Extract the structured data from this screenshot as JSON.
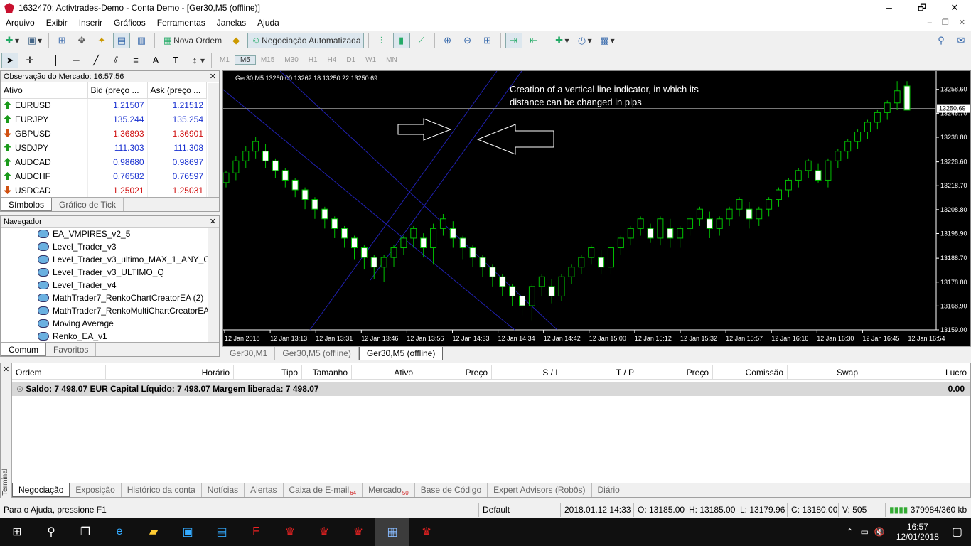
{
  "window": {
    "title": "1632470: Activtrades-Demo - Conta Demo - [Ger30,M5 (offline)]",
    "minimize": "🗕",
    "restore": "🗗",
    "close": "✕"
  },
  "menu": [
    "Arquivo",
    "Exibir",
    "Inserir",
    "Gráficos",
    "Ferramentas",
    "Janelas",
    "Ajuda"
  ],
  "toolbar": {
    "new_order": "Nova Ordem",
    "auto_trading": "Negociação Automatizada"
  },
  "timeframes": [
    "M1",
    "M5",
    "M15",
    "M30",
    "H1",
    "H4",
    "D1",
    "W1",
    "MN"
  ],
  "active_timeframe": "M5",
  "market_watch": {
    "title": "Observação do Mercado: 16:57:56",
    "columns": [
      "Ativo",
      "Bid (preço ...",
      "Ask (preço ..."
    ],
    "rows": [
      {
        "symbol": "EURUSD",
        "bid": "1.21507",
        "ask": "1.21512",
        "dir": "up",
        "color": "blue"
      },
      {
        "symbol": "EURJPY",
        "bid": "135.244",
        "ask": "135.254",
        "dir": "up",
        "color": "blue"
      },
      {
        "symbol": "GBPUSD",
        "bid": "1.36893",
        "ask": "1.36901",
        "dir": "down",
        "color": "red"
      },
      {
        "symbol": "USDJPY",
        "bid": "111.303",
        "ask": "111.308",
        "dir": "up",
        "color": "blue"
      },
      {
        "symbol": "AUDCAD",
        "bid": "0.98680",
        "ask": "0.98697",
        "dir": "up",
        "color": "blue"
      },
      {
        "symbol": "AUDCHF",
        "bid": "0.76582",
        "ask": "0.76597",
        "dir": "up",
        "color": "blue"
      },
      {
        "symbol": "USDCAD",
        "bid": "1.25021",
        "ask": "1.25031",
        "dir": "down",
        "color": "red"
      }
    ],
    "tabs": [
      "Símbolos",
      "Gráfico de Tick"
    ]
  },
  "navigator": {
    "title": "Navegador",
    "items": [
      "EA_VMPIRES_v2_5",
      "Level_Trader_v3",
      "Level_Trader_v3_ultimo_MAX_1_ANY_OR",
      "Level_Trader_v3_ULTIMO_Q",
      "Level_Trader_v4",
      "MathTrader7_RenkoChartCreatorEA (2)",
      "MathTrader7_RenkoMultiChartCreatorEA",
      "Moving Average",
      "Renko_EA_v1"
    ],
    "tabs": [
      "Comum",
      "Favoritos"
    ]
  },
  "chart": {
    "header": "Ger30,M5  13260.00 13262.18 13250.22 13250.69",
    "annotation_line1": "Creation of a vertical line indicator, in which its",
    "annotation_line2": "distance can be changed in pips",
    "current_price": "13250.69",
    "tabs": [
      "Ger30,M1",
      "Ger30,M5 (offline)",
      "Ger30,M5 (offline)"
    ]
  },
  "chart_data": {
    "type": "candlestick",
    "symbol": "Ger30,M5",
    "ylim": [
      13159,
      13265
    ],
    "y_ticks": [
      "13258.60",
      "13248.70",
      "13238.80",
      "13228.60",
      "13218.70",
      "13208.80",
      "13198.90",
      "13188.70",
      "13178.80",
      "13168.90",
      "13159.00"
    ],
    "x_ticks": [
      "12 Jan 2018",
      "12 Jan 13:13",
      "12 Jan 13:31",
      "12 Jan 13:46",
      "12 Jan 13:56",
      "12 Jan 14:33",
      "12 Jan 14:34",
      "12 Jan 14:42",
      "12 Jan 15:00",
      "12 Jan 15:12",
      "12 Jan 15:32",
      "12 Jan 15:57",
      "12 Jan 16:16",
      "12 Jan 16:30",
      "12 Jan 16:45",
      "12 Jan 16:54"
    ],
    "ohlc": [
      [
        13220,
        13225,
        13218,
        13224
      ],
      [
        13224,
        13231,
        13221,
        13229
      ],
      [
        13229,
        13235,
        13226,
        13233
      ],
      [
        13233,
        13239,
        13230,
        13237
      ],
      [
        13233,
        13236,
        13226,
        13229
      ],
      [
        13229,
        13230,
        13222,
        13225
      ],
      [
        13225,
        13226,
        13218,
        13221
      ],
      [
        13221,
        13222,
        13214,
        13217
      ],
      [
        13217,
        13218,
        13209,
        13213
      ],
      [
        13213,
        13214,
        13205,
        13209
      ],
      [
        13209,
        13210,
        13201,
        13205
      ],
      [
        13205,
        13206,
        13197,
        13201
      ],
      [
        13201,
        13202,
        13193,
        13197
      ],
      [
        13197,
        13198,
        13188,
        13193
      ],
      [
        13193,
        13194,
        13184,
        13189
      ],
      [
        13189,
        13190,
        13180,
        13185
      ],
      [
        13185,
        13190,
        13179,
        13189
      ],
      [
        13189,
        13194,
        13185,
        13193
      ],
      [
        13193,
        13198,
        13190,
        13197
      ],
      [
        13197,
        13202,
        13193,
        13201
      ],
      [
        13197,
        13199,
        13189,
        13193
      ],
      [
        13193,
        13203,
        13186,
        13201
      ],
      [
        13201,
        13207,
        13198,
        13205
      ],
      [
        13201,
        13204,
        13193,
        13197
      ],
      [
        13197,
        13198,
        13188,
        13193
      ],
      [
        13193,
        13194,
        13185,
        13189
      ],
      [
        13189,
        13190,
        13181,
        13185
      ],
      [
        13185,
        13186,
        13177,
        13181
      ],
      [
        13181,
        13182,
        13173,
        13177
      ],
      [
        13177,
        13178,
        13169,
        13173
      ],
      [
        13173,
        13174,
        13165,
        13169
      ],
      [
        13169,
        13178,
        13163,
        13177
      ],
      [
        13177,
        13182,
        13173,
        13181
      ],
      [
        13177,
        13180,
        13170,
        13173
      ],
      [
        13173,
        13182,
        13171,
        13181
      ],
      [
        13181,
        13186,
        13178,
        13185
      ],
      [
        13185,
        13190,
        13182,
        13189
      ],
      [
        13189,
        13194,
        13186,
        13193
      ],
      [
        13189,
        13192,
        13182,
        13185
      ],
      [
        13185,
        13194,
        13182,
        13193
      ],
      [
        13193,
        13198,
        13190,
        13197
      ],
      [
        13197,
        13202,
        13194,
        13201
      ],
      [
        13201,
        13206,
        13198,
        13205
      ],
      [
        13201,
        13203,
        13195,
        13197
      ],
      [
        13197,
        13206,
        13194,
        13205
      ],
      [
        13201,
        13205,
        13193,
        13197
      ],
      [
        13197,
        13202,
        13193,
        13201
      ],
      [
        13201,
        13206,
        13198,
        13205
      ],
      [
        13205,
        13210,
        13202,
        13209
      ],
      [
        13205,
        13208,
        13197,
        13201
      ],
      [
        13201,
        13206,
        13198,
        13205
      ],
      [
        13205,
        13210,
        13202,
        13209
      ],
      [
        13209,
        13214,
        13206,
        13213
      ],
      [
        13209,
        13212,
        13201,
        13205
      ],
      [
        13205,
        13210,
        13202,
        13209
      ],
      [
        13209,
        13214,
        13206,
        13213
      ],
      [
        13213,
        13218,
        13210,
        13217
      ],
      [
        13217,
        13222,
        13214,
        13221
      ],
      [
        13221,
        13226,
        13218,
        13225
      ],
      [
        13225,
        13230,
        13222,
        13229
      ],
      [
        13225,
        13228,
        13220,
        13221
      ],
      [
        13221,
        13230,
        13218,
        13229
      ],
      [
        13229,
        13234,
        13226,
        13233
      ],
      [
        13233,
        13238,
        13230,
        13237
      ],
      [
        13237,
        13242,
        13234,
        13241
      ],
      [
        13241,
        13246,
        13238,
        13245
      ],
      [
        13245,
        13250,
        13242,
        13249
      ],
      [
        13249,
        13254,
        13246,
        13253
      ],
      [
        13253,
        13262,
        13250,
        13258
      ],
      [
        13260,
        13262,
        13250,
        13250
      ]
    ]
  },
  "terminal": {
    "columns": [
      "Ordem",
      "Horário",
      "Tipo",
      "Tamanho",
      "Ativo",
      "Preço",
      "S / L",
      "T / P",
      "Preço",
      "Comissão",
      "Swap",
      "Lucro"
    ],
    "balance": "Saldo: 7 498.07 EUR  Capital Líquido: 7 498.07  Margem liberada: 7 498.07",
    "profit": "0.00",
    "side_label": "Terminal",
    "tabs": [
      {
        "label": "Negociação"
      },
      {
        "label": "Exposição"
      },
      {
        "label": "Histórico da conta"
      },
      {
        "label": "Notícias"
      },
      {
        "label": "Alertas"
      },
      {
        "label": "Caixa de E-mail",
        "badge": "64"
      },
      {
        "label": "Mercado",
        "badge": "50"
      },
      {
        "label": "Base de Código"
      },
      {
        "label": "Expert Advisors (Robôs)"
      },
      {
        "label": "Diário"
      }
    ]
  },
  "status": {
    "help": "Para o Ajuda, pressione F1",
    "profile": "Default",
    "datetime": "2018.01.12 14:33",
    "open": "O: 13185.00",
    "high": "H: 13185.00",
    "low": "L: 13179.96",
    "close": "C: 13180.00",
    "volume": "V: 505",
    "traffic": "379984/360 kb"
  },
  "taskbar": {
    "time": "16:57",
    "date": "12/01/2018"
  }
}
